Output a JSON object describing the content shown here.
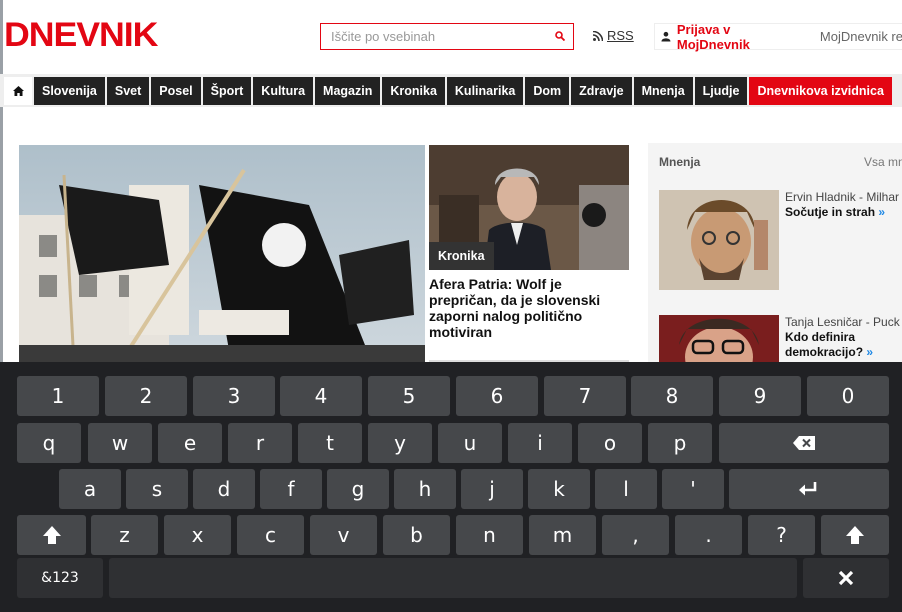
{
  "header": {
    "logo": "DNEVNIK",
    "search_placeholder": "Iščite po vsebinah",
    "rss": "RSS",
    "login": "Prijava v MojDnevnik",
    "mydnevnik": "MojDnevnik re"
  },
  "nav": {
    "items": [
      "Slovenija",
      "Svet",
      "Posel",
      "Šport",
      "Kultura",
      "Magazin",
      "Kronika",
      "Kulinarika",
      "Dom",
      "Zdravje",
      "Mnenja",
      "Ljudje",
      "Dnevnikova izvidnica"
    ]
  },
  "side_article": {
    "tag": "Kronika",
    "headline": "Afera Patria: Wolf je prepričan, da je slovenski zaporni nalog politično motiviran"
  },
  "opinions": {
    "header": "Mnenja",
    "all": "Vsa mn",
    "items": [
      {
        "author": "Ervin Hladnik - Milhar",
        "title": "Sočutje in strah",
        "arrow": "»"
      },
      {
        "author": "Tanja Lesničar - Puck",
        "title": "Kdo definira demokracijo?",
        "arrow": "»"
      }
    ]
  },
  "keyboard": {
    "row1": [
      "1",
      "2",
      "3",
      "4",
      "5",
      "6",
      "7",
      "8",
      "9",
      "0"
    ],
    "row2": [
      "q",
      "w",
      "e",
      "r",
      "t",
      "y",
      "u",
      "i",
      "o",
      "p"
    ],
    "row3": [
      "a",
      "s",
      "d",
      "f",
      "g",
      "h",
      "j",
      "k",
      "l",
      "'"
    ],
    "row4": [
      "z",
      "x",
      "c",
      "v",
      "b",
      "n",
      "m",
      ",",
      ".",
      "?"
    ],
    "symbols": "&123"
  }
}
